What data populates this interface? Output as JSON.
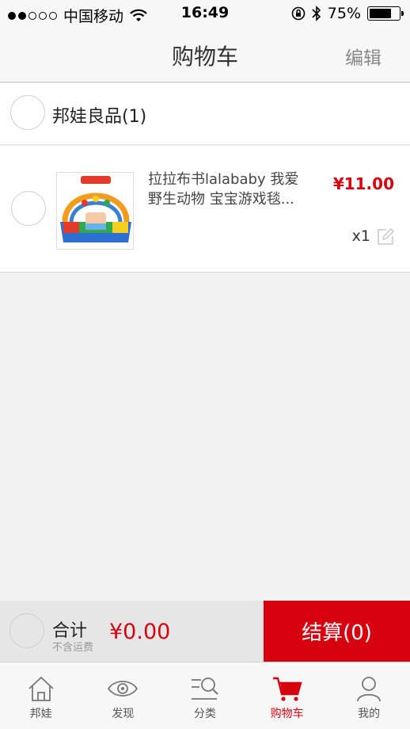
{
  "status_bar": {
    "carrier": "中国移动",
    "time": "16:49",
    "battery_text": "75%",
    "battery_level": 0.75
  },
  "nav": {
    "title": "购物车",
    "edit_label": "编辑"
  },
  "shop": {
    "name": "邦娃良品(1)"
  },
  "items": [
    {
      "title": "拉拉布书lalababy 我爱野生动物 宝宝游戏毯...",
      "price": "¥11.00",
      "qty": "x1",
      "thumb_icon": "play-mat-product-image"
    }
  ],
  "summary": {
    "total_label": "合计",
    "shipping_note": "不含运费",
    "total": "¥0.00",
    "checkout_label": "结算(0)"
  },
  "tabs": [
    {
      "label": "邦娃",
      "icon": "home-icon"
    },
    {
      "label": "发现",
      "icon": "eye-icon"
    },
    {
      "label": "分类",
      "icon": "category-search-icon"
    },
    {
      "label": "购物车",
      "icon": "cart-icon",
      "active": true
    },
    {
      "label": "我的",
      "icon": "user-icon"
    }
  ],
  "colors": {
    "accent": "#d7000f",
    "background": "#f2f2f2"
  }
}
